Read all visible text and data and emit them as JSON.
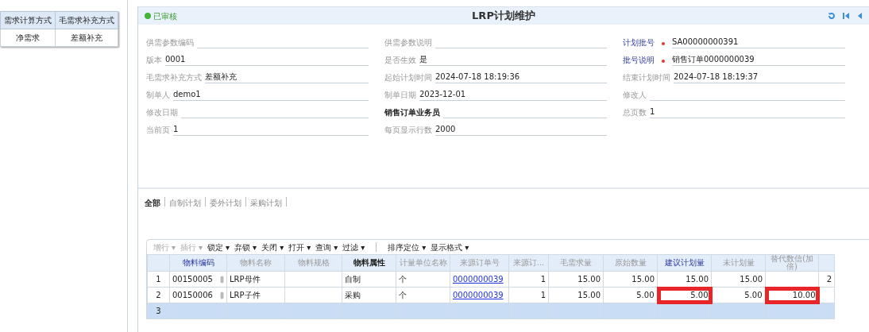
{
  "side_table": {
    "columns": [
      "需求计算方式",
      "毛需求补充方式"
    ],
    "rows": [
      [
        "净需求",
        "差额补充"
      ]
    ]
  },
  "header": {
    "status": "已审核",
    "title": "LRP计划维护"
  },
  "form": {
    "columns": [
      [
        {
          "label": "供需参数编码",
          "kind": "plain"
        },
        {
          "label": "版本",
          "kind": "plain",
          "value": "0001"
        },
        {
          "label": "毛需求补充方式",
          "kind": "plain",
          "value": "差额补充"
        },
        {
          "label": "制单人",
          "kind": "plain",
          "value": "demo1"
        },
        {
          "label": "修改日期",
          "kind": "plain"
        },
        {
          "label": "当前页",
          "kind": "plain",
          "value": "1"
        }
      ],
      [
        {
          "label": "供需参数说明",
          "kind": "plain"
        },
        {
          "label": "是否生效",
          "kind": "plain",
          "value": "是"
        },
        {
          "label": "起始计划时间",
          "kind": "plain",
          "value": "2024-07-18 18:19:36"
        },
        {
          "label": "制单日期",
          "kind": "plain",
          "value": "2023-12-01"
        },
        {
          "label": "销售订单业务员",
          "kind": "strong"
        },
        {
          "label": "每页显示行数",
          "kind": "plain",
          "value": "2000"
        }
      ],
      [
        {
          "label": "计划批号",
          "kind": "required",
          "value": "SA00000000391"
        },
        {
          "label": "批号说明",
          "kind": "required",
          "value": "销售订单0000000039"
        },
        {
          "label": "结束计划时间",
          "kind": "plain",
          "value": "2024-07-18 18:19:37"
        },
        {
          "label": "修改人",
          "kind": "plain"
        },
        {
          "label": "总页数",
          "kind": "plain",
          "value": "1"
        }
      ]
    ]
  },
  "tabs": [
    {
      "label": "全部",
      "selected": true
    },
    {
      "label": "自制计划",
      "selected": false
    },
    {
      "label": "委外计划",
      "selected": false
    },
    {
      "label": "采购计划",
      "selected": false
    }
  ],
  "toolbar": [
    {
      "label": "增行",
      "caret": "▾",
      "disabled": true
    },
    {
      "label": "插行",
      "caret": "▾",
      "disabled": true
    },
    {
      "label": "锁定",
      "caret": "▾",
      "disabled": false
    },
    {
      "label": "弃锁",
      "caret": "▾",
      "disabled": false
    },
    {
      "label": "关闭",
      "caret": "▾",
      "disabled": false
    },
    {
      "label": "打开",
      "caret": "▾",
      "disabled": false
    },
    {
      "label": "查询",
      "caret": "▾",
      "disabled": false
    },
    {
      "label": "过滤",
      "caret": "▾",
      "disabled": false
    },
    {
      "label": "排序定位",
      "caret": "▾",
      "disabled": false
    },
    {
      "label": "显示格式",
      "caret": "▾",
      "disabled": false
    }
  ],
  "grid": {
    "columns": [
      {
        "label": "物料编码",
        "kind": "key"
      },
      {
        "label": "物料名称",
        "kind": "plain"
      },
      {
        "label": "物料规格",
        "kind": "plain"
      },
      {
        "label": "物料属性",
        "kind": "strong"
      },
      {
        "label": "计量单位名称",
        "kind": "plain"
      },
      {
        "label": "来源订单号",
        "kind": "plain"
      },
      {
        "label": "来源订...",
        "kind": "plain"
      },
      {
        "label": "毛需求量",
        "kind": "plain"
      },
      {
        "label": "原始数量",
        "kind": "plain"
      },
      {
        "label": "建议计划量",
        "kind": "key"
      },
      {
        "label": "未计划量",
        "kind": "plain"
      },
      {
        "label": "替代数信(加倍)",
        "kind": "plain"
      }
    ],
    "rows": [
      {
        "number": "1",
        "selected": false,
        "cells": [
          {
            "text": "00150005",
            "highlighted": false
          },
          {
            "text": "LRP母件",
            "highlighted": false
          },
          {
            "highlighted": false
          },
          {
            "text": "自制",
            "highlighted": false
          },
          {
            "text": "个",
            "highlighted": false
          },
          {
            "text": "0000000039",
            "highlighted": false
          },
          {
            "text": "1",
            "highlighted": false
          },
          {
            "text": "15.00",
            "highlighted": false
          },
          {
            "text": "15.00",
            "highlighted": false
          },
          {
            "text": "15.00",
            "highlighted": false
          },
          {
            "text": "15.00",
            "highlighted": false
          },
          {
            "highlighted": false
          },
          {
            "text": "2",
            "highlighted": false
          }
        ]
      },
      {
        "number": "2",
        "selected": false,
        "cells": [
          {
            "text": "00150006",
            "highlighted": false
          },
          {
            "text": "LRP子件",
            "highlighted": false
          },
          {
            "highlighted": false
          },
          {
            "text": "采购",
            "highlighted": false
          },
          {
            "text": "个",
            "highlighted": false
          },
          {
            "text": "0000000039",
            "highlighted": false
          },
          {
            "text": "1",
            "highlighted": false
          },
          {
            "text": "15.00",
            "highlighted": false
          },
          {
            "text": "5.00",
            "highlighted": false
          },
          {
            "text": "5.00",
            "highlighted": true
          },
          {
            "text": "5.00",
            "highlighted": false
          },
          {
            "text": "10.00",
            "highlighted": true
          },
          {
            "highlighted": false
          }
        ]
      },
      {
        "number": "3",
        "selected": true,
        "cells": []
      }
    ]
  }
}
